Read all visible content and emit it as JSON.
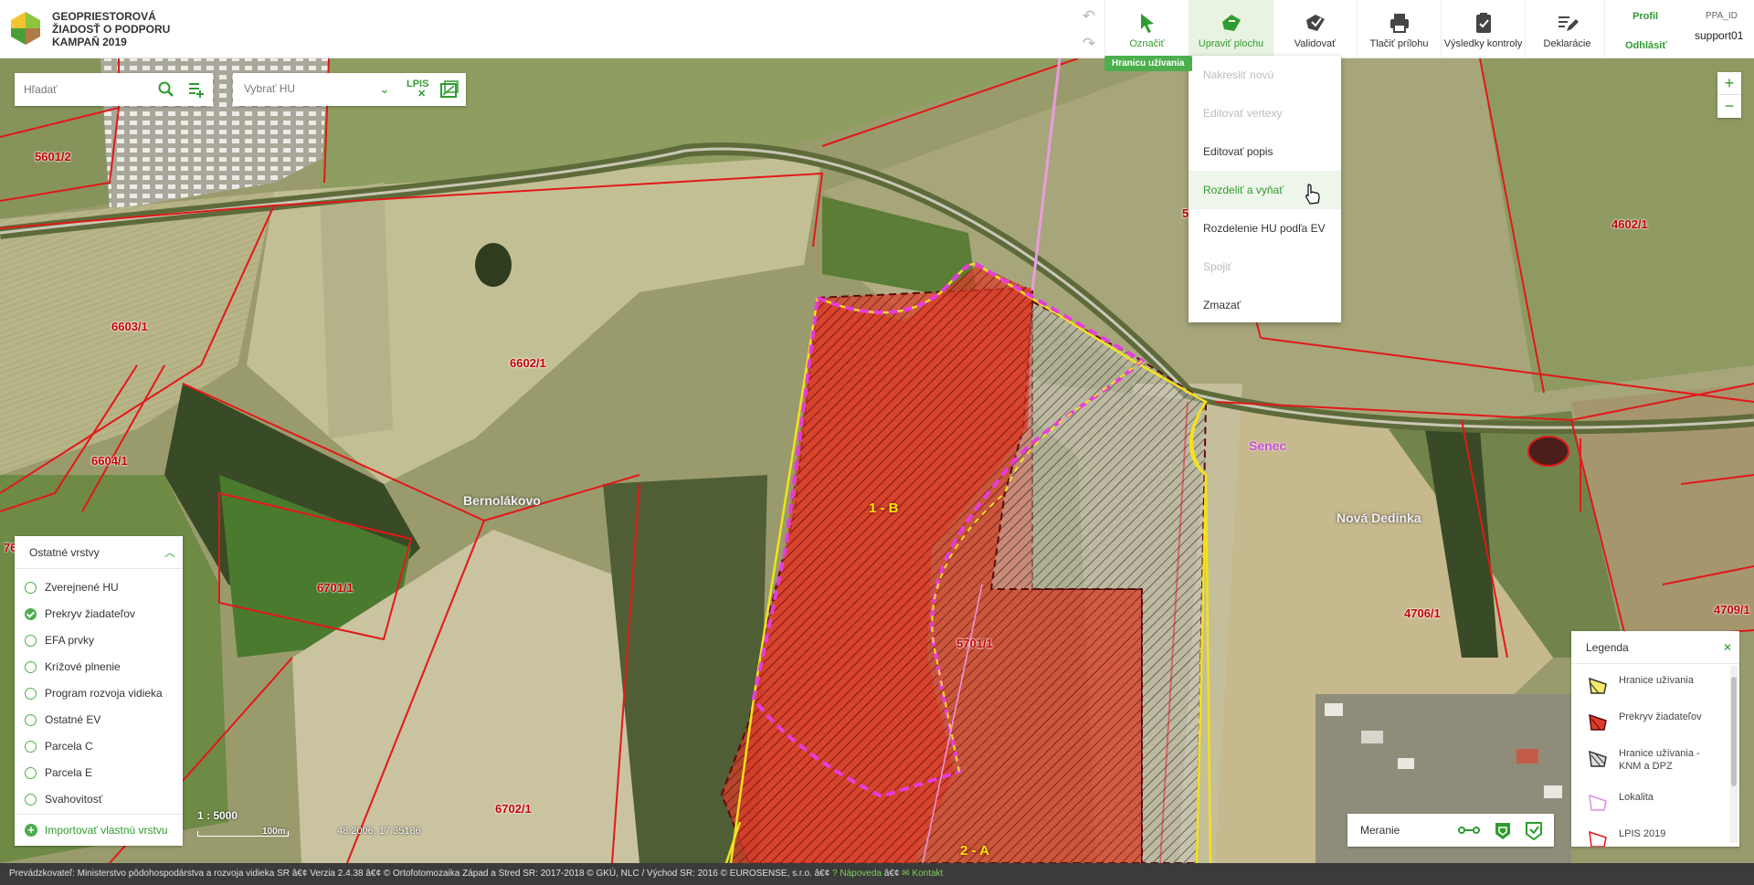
{
  "app": {
    "title_lines": [
      "GEOPRIESTOROVÁ",
      "ŽIADOSŤ O PODPORU",
      "KAMPAŇ 2019"
    ]
  },
  "toolbar": {
    "tools": [
      {
        "label": "Označiť",
        "icon": "cursor-arrow-icon",
        "active": false
      },
      {
        "label": "Upraviť plochu",
        "icon": "edit-area-icon",
        "active": true
      },
      {
        "label": "Validovať",
        "icon": "validate-icon",
        "active": false
      },
      {
        "label": "Tlačiť prílohu",
        "icon": "printer-icon",
        "active": false
      },
      {
        "label": "Výsledky kontroly",
        "icon": "clipboard-check-icon",
        "active": false
      },
      {
        "label": "Deklarácie",
        "icon": "declaration-pen-icon",
        "active": false
      }
    ],
    "tooltip": "Hranicu užívania"
  },
  "user": {
    "profile_label": "Profil",
    "logout_label": "Odhlásiť",
    "id_label": "PPA_ID",
    "id_value": "support01"
  },
  "edit_menu": {
    "items": [
      {
        "label": "Nakresliť novú",
        "disabled": true
      },
      {
        "label": "Editovať vertexy",
        "disabled": true
      },
      {
        "label": "Editovať popis",
        "disabled": false
      },
      {
        "label": "Rozdeliť a vyňať",
        "disabled": false,
        "hover": true
      },
      {
        "label": "Rozdelenie HU podľa EV",
        "disabled": false
      },
      {
        "label": "Spojiť",
        "disabled": true
      },
      {
        "label": "Zmazať",
        "disabled": false
      }
    ]
  },
  "search": {
    "placeholder": "Hľadať"
  },
  "hu_select": {
    "placeholder": "Vybrať HU",
    "lpis_label": "LPIS"
  },
  "zoom": {
    "in": "+",
    "out": "−"
  },
  "layers": {
    "title": "Ostatné vrstvy",
    "items": [
      {
        "label": "Zverejnené HU",
        "checked": false
      },
      {
        "label": "Prekryv žiadateľov",
        "checked": true
      },
      {
        "label": "EFA prvky",
        "checked": false
      },
      {
        "label": "Krížové plnenie",
        "checked": false
      },
      {
        "label": "Program rozvoja vidieka",
        "checked": false
      },
      {
        "label": "Ostatné EV",
        "checked": false
      },
      {
        "label": "Parcela C",
        "checked": false
      },
      {
        "label": "Parcela E",
        "checked": false
      },
      {
        "label": "Svahovitosť",
        "checked": false
      }
    ],
    "import_label": "Importovať vlastnú vrstvu"
  },
  "scale": {
    "ratio": "1 : 5000",
    "bar_label": "100m"
  },
  "coordinates": "48.2006, 17.35186",
  "measure": {
    "label": "Meranie"
  },
  "legend": {
    "title": "Legenda",
    "items": [
      {
        "label": "Hranice užívania"
      },
      {
        "label": "Prekryv žiadateľov"
      },
      {
        "label": "Hranice užívania - KNM a DPZ"
      },
      {
        "label": "Lokalita"
      },
      {
        "label": "LPIS 2019"
      }
    ]
  },
  "map_labels": {
    "parcels": [
      "5601/2",
      "6603/1",
      "6602/1",
      "6604/1",
      "6701/1",
      "6702/1",
      "5701/1",
      "4602/1",
      "4706/1",
      "4709/1",
      "76",
      "5"
    ],
    "towns": [
      "Bernolákovo",
      "Senec",
      "Nová Dedinka"
    ],
    "hu": [
      "1 - B",
      "2 - A"
    ]
  },
  "footer": {
    "text": "Prevádzkovateľ: Ministerstvo pôdohospodárstva a rozvoja vidieka SR â€¢ Verzia 2.4.38 â€¢ © Ortofotomozaika Západ a Stred SR: 2017-2018 © GKÚ, NLC / Východ SR: 2016 © EUROSENSE, s.r.o.  â€¢ ",
    "help_label": "? Nápoveda",
    "sep": " â€¢ ",
    "contact_label": "Kontakt"
  }
}
